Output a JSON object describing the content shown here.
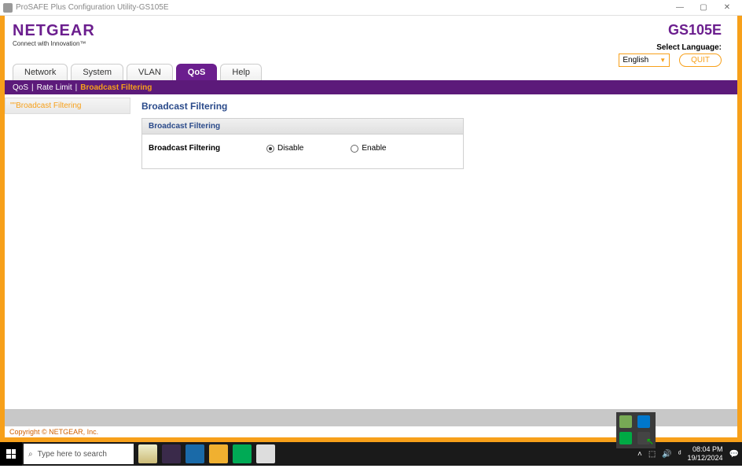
{
  "window": {
    "title": "ProSAFE Plus Configuration Utility-GS105E"
  },
  "brand": {
    "name": "NETGEAR",
    "tagline": "Connect with Innovation™"
  },
  "model": "GS105E",
  "language": {
    "label": "Select Language:",
    "selected": "English"
  },
  "quit_label": "QUIT",
  "tabs": {
    "network": "Network",
    "system": "System",
    "vlan": "VLAN",
    "qos": "QoS",
    "help": "Help"
  },
  "subnav": {
    "qos": "QoS",
    "rate_limit": "Rate Limit",
    "broadcast": "Broadcast Filtering"
  },
  "sidebar": {
    "broadcast": "\"\"Broadcast Filtering"
  },
  "panel": {
    "title": "Broadcast Filtering",
    "section_header": "Broadcast Filtering",
    "setting_label": "Broadcast Filtering",
    "opt_disable": "Disable",
    "opt_enable": "Enable"
  },
  "copyright": "Copyright © NETGEAR, Inc.",
  "taskbar": {
    "search_placeholder": "Type here to search",
    "time": "08:04 PM",
    "date": "19/12/2024"
  }
}
